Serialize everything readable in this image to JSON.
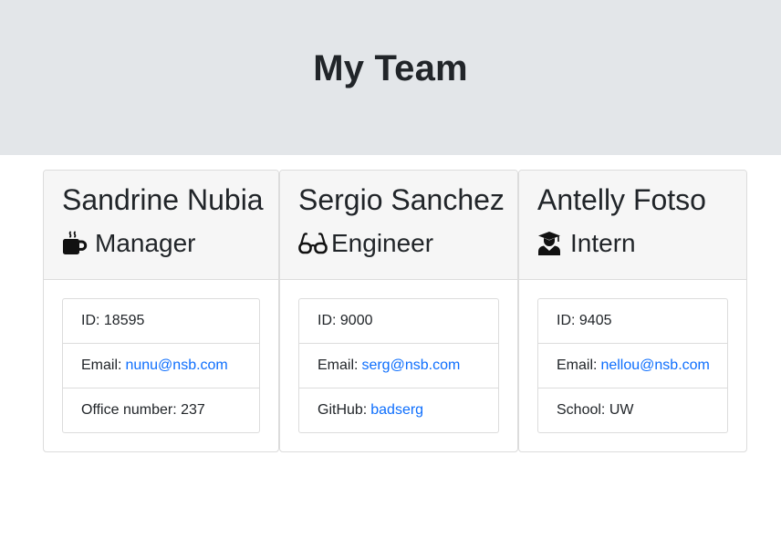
{
  "header": {
    "title": "My Team"
  },
  "cards": [
    {
      "name": "Sandrine Nubia",
      "role": "Manager",
      "icon": "mug-icon",
      "id_label": "ID: 18595",
      "email_label": "Email:",
      "email": "nunu@nsb.com",
      "extra_text": "Office number: 237"
    },
    {
      "name": "Sergio Sanchez",
      "role": "Engineer",
      "icon": "glasses-icon",
      "id_label": "ID: 9000",
      "email_label": "Email:",
      "email": "serg@nsb.com",
      "extra_label": "GitHub:",
      "extra_link": "badserg"
    },
    {
      "name": "Antelly Fotso",
      "role": "Intern",
      "icon": "graduate-icon",
      "id_label": "ID: 9405",
      "email_label": "Email:",
      "email": "nellou@nsb.com",
      "extra_text": "School: UW"
    }
  ],
  "colors": {
    "jumbotron": "#e3e6e9",
    "link": "#0d6efd",
    "card_header": "#f6f6f6"
  }
}
